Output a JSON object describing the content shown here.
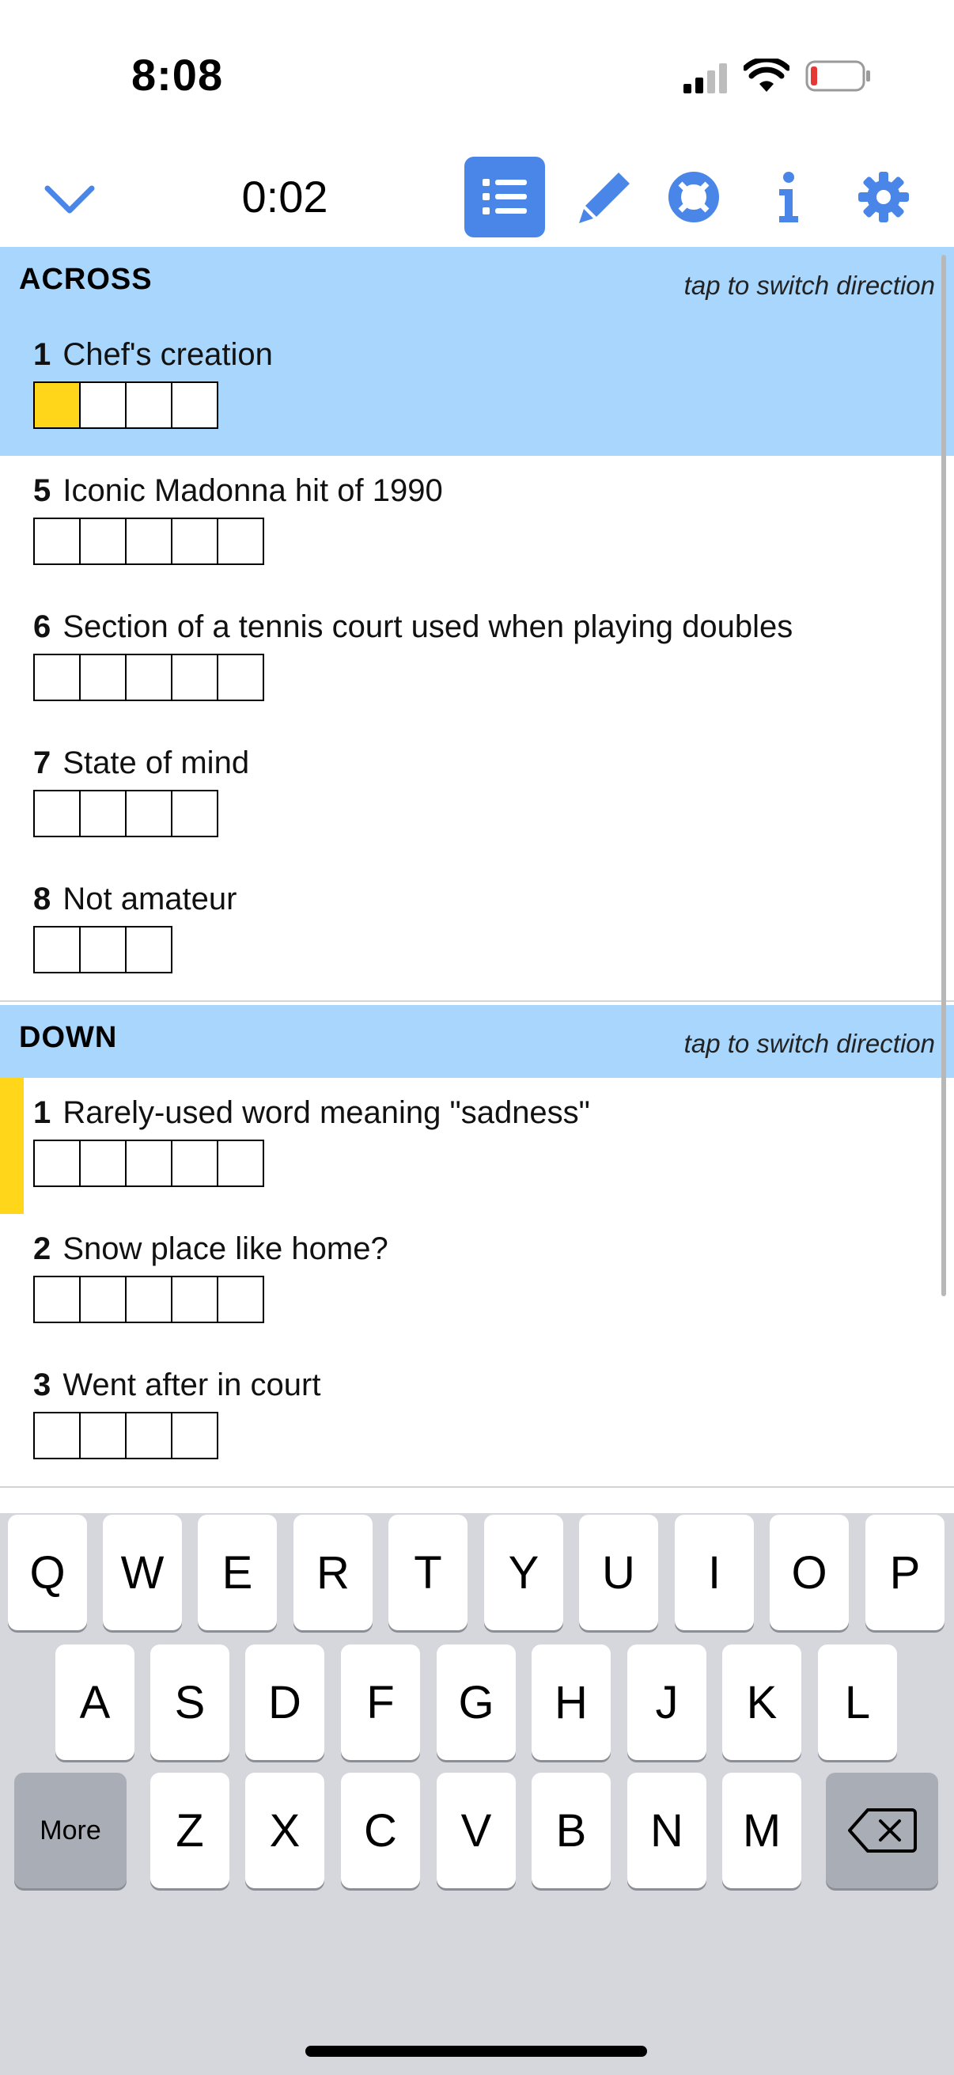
{
  "status_bar": {
    "time": "8:08"
  },
  "toolbar": {
    "timer": "0:02"
  },
  "clues": {
    "across": {
      "title": "ACROSS",
      "hint": "tap to switch direction",
      "items": [
        {
          "number": "1",
          "text": "Chef's creation",
          "length": 4
        },
        {
          "number": "5",
          "text": "Iconic Madonna hit of 1990",
          "length": 5
        },
        {
          "number": "6",
          "text": "Section of a tennis court used when playing doubles",
          "length": 5
        },
        {
          "number": "7",
          "text": "State of mind",
          "length": 4
        },
        {
          "number": "8",
          "text": "Not amateur",
          "length": 3
        }
      ]
    },
    "down": {
      "title": "DOWN",
      "hint": "tap to switch direction",
      "items": [
        {
          "number": "1",
          "text": "Rarely-used word meaning \"sadness\"",
          "length": 5
        },
        {
          "number": "2",
          "text": "Snow place like home?",
          "length": 5
        },
        {
          "number": "3",
          "text": "Went after in court",
          "length": 4
        }
      ]
    }
  },
  "keyboard": {
    "row1": [
      "Q",
      "W",
      "E",
      "R",
      "T",
      "Y",
      "U",
      "I",
      "O",
      "P"
    ],
    "row2": [
      "A",
      "S",
      "D",
      "F",
      "G",
      "H",
      "J",
      "K",
      "L"
    ],
    "row3": [
      "Z",
      "X",
      "C",
      "V",
      "B",
      "N",
      "M"
    ],
    "more_label": "More"
  },
  "colors": {
    "accent": "#4a86e8",
    "highlight": "#a8d6fd",
    "cursor": "#ffd61a"
  }
}
